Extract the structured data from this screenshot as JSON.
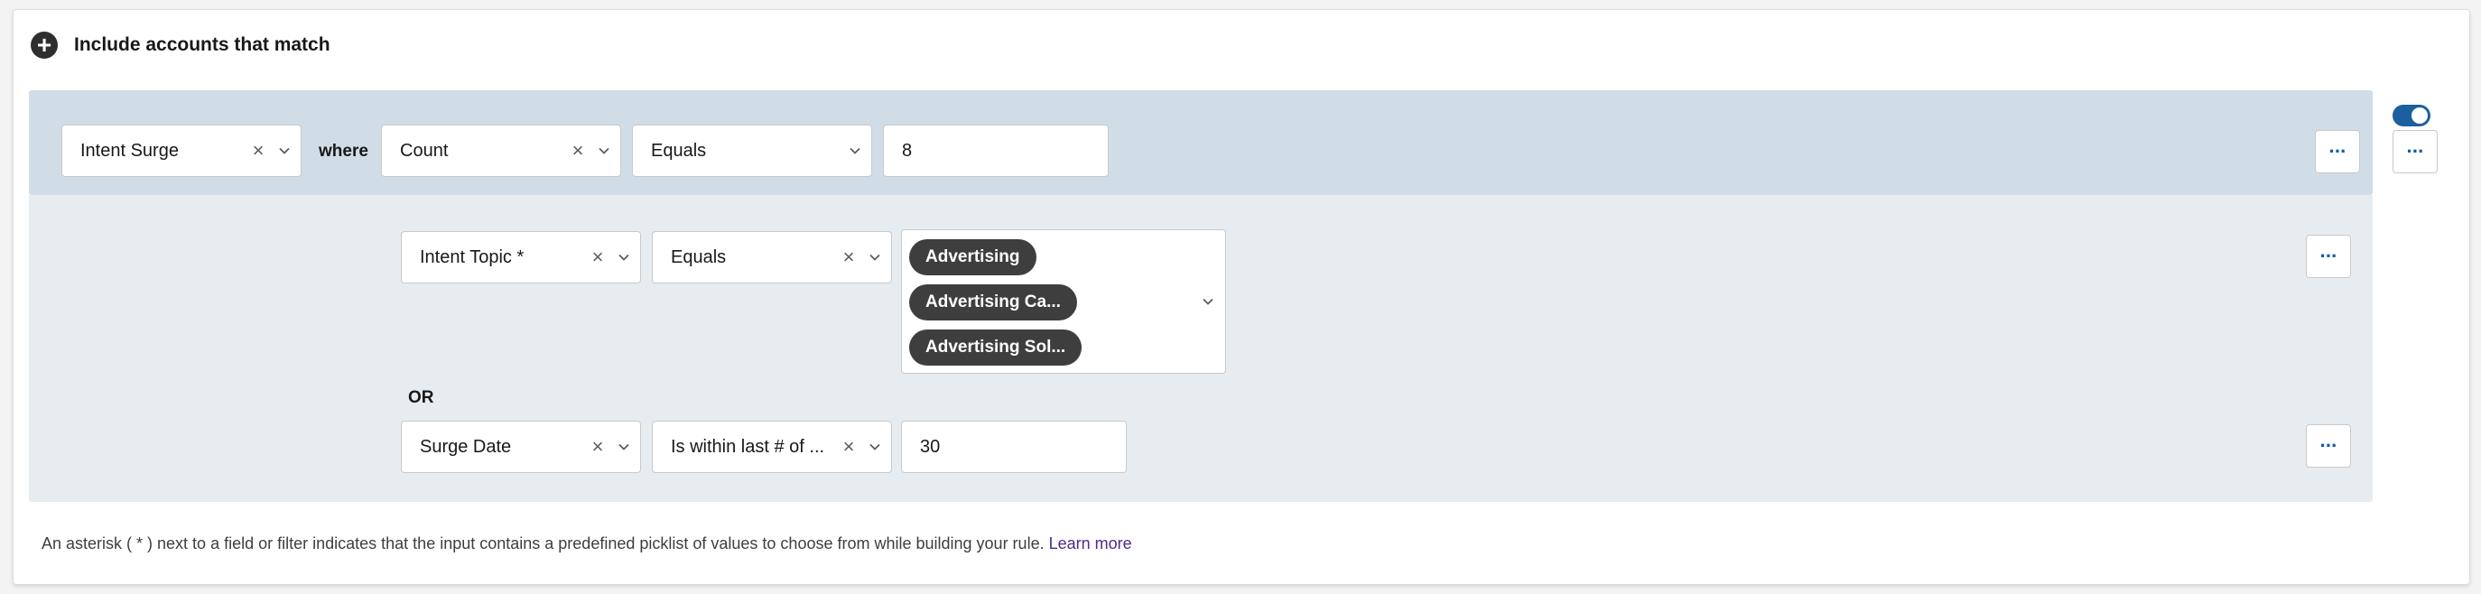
{
  "header": {
    "title": "Include accounts that match"
  },
  "rule": {
    "object_value": "Intent Surge",
    "where_label": "where",
    "field_value": "Count",
    "operator_value": "Equals",
    "input_value": "8"
  },
  "conditions": [
    {
      "field_value": "Intent Topic *",
      "operator_value": "Equals",
      "values": [
        "Advertising",
        "Advertising Ca...",
        "Advertising Sol..."
      ]
    },
    {
      "connector": "OR",
      "field_value": "Surge Date",
      "operator_value": "Is within last # of ...",
      "input_value": "30"
    }
  ],
  "footer": {
    "note": "An asterisk ( * ) next to a field or filter indicates that the input contains a predefined picklist of values to choose from while building your rule.",
    "link": "Learn more"
  },
  "icons": {
    "add": "plus-circle-icon",
    "clear": "close-icon",
    "dropdown": "chevron-down-icon",
    "more": "more-horizontal-icon"
  },
  "colors": {
    "rule_bg": "#d1dde6",
    "conditions_bg": "#e6ecf0",
    "accent": "#0b5cab",
    "toggle": "#1b5f9e",
    "pill": "#3e3e3e",
    "link": "#4b2b8f"
  },
  "toggle": {
    "on": true
  }
}
